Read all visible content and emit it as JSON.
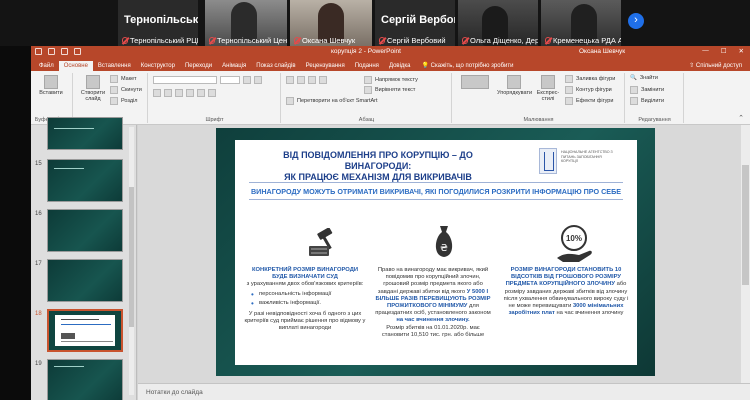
{
  "video_call": {
    "tiles": [
      {
        "big_name": "Тернопільськ...",
        "label": "Тернопільський РЦП"
      },
      {
        "big_name": "",
        "label": "Тернопільський Цент..."
      },
      {
        "big_name": "",
        "label": "Оксана Шевчук"
      },
      {
        "big_name": "Сергій Вербовий",
        "label": "Сергій Вербовий"
      },
      {
        "big_name": "",
        "label": "Ольга Діщенко, Держ..."
      },
      {
        "big_name": "",
        "label": "Кременецька РДА Ан..."
      }
    ],
    "next_icon": "›"
  },
  "window": {
    "title": "корупція 2  -  PowerPoint",
    "user": "Оксана Шевчук",
    "tabs": [
      "Файл",
      "Основне",
      "Вставлення",
      "Конструктор",
      "Переходи",
      "Анімація",
      "Показ слайдів",
      "Рецензування",
      "Подання",
      "Довідка"
    ],
    "active_tab": "Основне",
    "help_search": "Скажіть, що потрібно зробити",
    "share": "Спільний доступ"
  },
  "ribbon": {
    "groups": [
      "Буфер обміну",
      "Слайди",
      "Шрифт",
      "Абзац",
      "Малювання",
      "Редагування"
    ],
    "paste": "Вставити",
    "new_slide": "Створити слайд",
    "layout": "Макет",
    "reset": "Скинути",
    "section": "Розділ",
    "text_direction": "Напрямок тексту",
    "align_text": "Вирівняти текст",
    "smartart": "Перетворити на об'єкт SmartArt",
    "shapes": "Фігури",
    "arrange": "Упорядкувати",
    "quick_styles": "Експрес-стилі",
    "shape_fill": "Заливка фігури",
    "shape_outline": "Контур фігури",
    "shape_effects": "Ефекти фігури",
    "find": "Знайти",
    "replace": "Замінити",
    "select": "Виділити"
  },
  "thumbnails": [
    {
      "num": "",
      "selected": false
    },
    {
      "num": "15",
      "selected": false
    },
    {
      "num": "16",
      "selected": false
    },
    {
      "num": "17",
      "selected": false
    },
    {
      "num": "18",
      "selected": true
    },
    {
      "num": "19",
      "selected": false
    }
  ],
  "slide": {
    "title_line1": "ВІД ПОВІДОМЛЕННЯ ПРО КОРУПЦІЮ – ДО ВИНАГОРОДИ:",
    "title_line2": "ЯК ПРАЦЮЄ МЕХАНІЗМ ДЛЯ ВИКРИВАЧІВ",
    "logo_text": "НАЦІОНАЛЬНЕ АГЕНТСТВО З ПИТАНЬ ЗАПОБІГАННЯ КОРУПЦІЇ",
    "subtitle": "ВИНАГОРОДУ МОЖУТЬ ОТРИМАТИ ВИКРИВАЧІ, ЯКІ ПОГОДИЛИСЯ РОЗКРИТИ ІНФОРМАЦІЮ ПРО СЕБЕ",
    "bag_symbol": "₴",
    "percent_label": "10%",
    "left": {
      "heading1": "КОНКРЕТНИЙ РОЗМІР ВИНАГОРОДИ",
      "heading2": "БУДЕ ВИЗНАЧАТИ СУД",
      "intro": "з урахуванням двох обов'язкових критеріїв:",
      "criteria": [
        "персональність інформації",
        "важливість інформації."
      ],
      "note": "У разі невідповідності хоча б одного з цих критеріїв суд приймає рішення про відмову у виплаті винагороди"
    },
    "middle": {
      "text1": "Право на винагороду має викривач, який повідомив про корупційний злочин, грошовий розмір предмета якого або завдані державі збитки від якого",
      "highlight": "У 5000 І БІЛЬШЕ РАЗІВ ПЕРЕВИЩУЮТЬ РОЗМІР ПРОЖИТКОВОГО МІНІМУМУ",
      "text2": "для працездатних осіб, установленого законом",
      "highlight2": "на час вчинення злочину.",
      "text3": "Розмір збитків на 01.01.2020р. має становити 10,510 тис. грн. або більше"
    },
    "right": {
      "highlight1": "РОЗМІР ВИНАГОРОДИ СТАНОВИТЬ 10 ВІДСОТКІВ ВІД ГРОШОВОГО РОЗМІРУ ПРЕДМЕТА КОРУПЦІЙНОГО ЗЛОЧИНУ",
      "text1": "або розміру завданих державі збитків від злочину після ухвалення обвинувального вироку суду і не може перевищувати",
      "highlight2": "3000 мінімальних заробітних плат",
      "text2": "на час вчинення злочину"
    }
  },
  "notes_placeholder": "Нотатки до слайда",
  "colors": {
    "ppt_accent": "#b7472a",
    "slide_heading": "#1d3f8a",
    "slide_subtitle": "#2c6cc2",
    "slide_bg": "#17554f"
  }
}
